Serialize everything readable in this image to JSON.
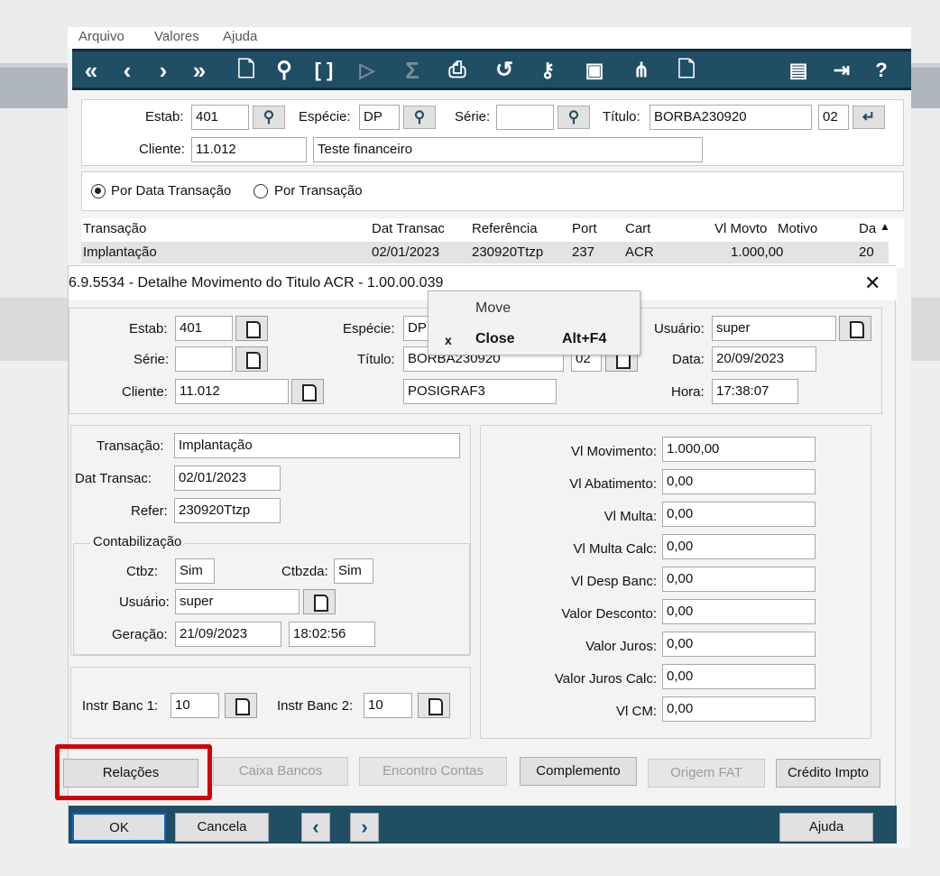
{
  "main": {
    "menu": [
      "Arquivo",
      "Valores",
      "Ajuda"
    ],
    "filter": {
      "estab_label": "Estab:",
      "estab": "401",
      "especie_label": "Espécie:",
      "especie": "DP",
      "serie_label": "Série:",
      "serie": "",
      "titulo_label": "Título:",
      "titulo": "BORBA230920",
      "parcela": "02",
      "cliente_label": "Cliente:",
      "cliente": "11.012",
      "cliente_nome": "Teste financeiro"
    },
    "radio": {
      "option1": "Por Data Transação",
      "option2": "Por Transação"
    },
    "grid": {
      "headers": [
        "Transação",
        "Dat Transac",
        "Referência",
        "Port",
        "Cart",
        "Vl Movto",
        "Motivo",
        "Da"
      ],
      "rows": [
        [
          "Implantação",
          "02/01/2023",
          "230920Ttzp",
          "237",
          "ACR",
          "1.000,00",
          "",
          "20"
        ]
      ]
    }
  },
  "dialog": {
    "title": "6.9.5534 - Detalhe Movimento do Titulo ACR - 1.00.00.039",
    "header": {
      "estab_label": "Estab:",
      "estab": "401",
      "serie_label": "Série:",
      "serie": "",
      "cliente_label": "Cliente:",
      "cliente": "11.012",
      "especie_label": "Espécie:",
      "especie": "DP",
      "titulo_label": "Título:",
      "titulo": "BORBA230920",
      "parcela": "02",
      "cliente_nome": "POSIGRAF3",
      "usuario_label": "Usuário:",
      "usuario": "super",
      "data_label": "Data:",
      "data": "20/09/2023",
      "hora_label": "Hora:",
      "hora": "17:38:07"
    },
    "left": {
      "transacao_label": "Transação:",
      "transacao": "Implantação",
      "dat_transac_label": "Dat Transac:",
      "dat_transac": "02/01/2023",
      "refer_label": "Refer:",
      "refer": "230920Ttzp",
      "contab_title": "Contabilização",
      "ctbz_label": "Ctbz:",
      "ctbz": "Sim",
      "ctbzda_label": "Ctbzda:",
      "ctbzda": "Sim",
      "usuario_label": "Usuário:",
      "usuario": "super",
      "geracao_label": "Geração:",
      "geracao_data": "21/09/2023",
      "geracao_hora": "18:02:56",
      "instr1_label": "Instr Banc 1:",
      "instr1": "10",
      "instr2_label": "Instr Banc 2:",
      "instr2": "10"
    },
    "values": [
      {
        "label": "Vl Movimento:",
        "value": "1.000,00"
      },
      {
        "label": "Vl Abatimento:",
        "value": "0,00"
      },
      {
        "label": "Vl Multa:",
        "value": "0,00"
      },
      {
        "label": "Vl Multa Calc:",
        "value": "0,00"
      },
      {
        "label": "Vl Desp Banc:",
        "value": "0,00"
      },
      {
        "label": "Valor Desconto:",
        "value": "0,00"
      },
      {
        "label": "Valor Juros:",
        "value": "0,00"
      },
      {
        "label": "Valor Juros Calc:",
        "value": "0,00"
      },
      {
        "label": "Vl CM:",
        "value": "0,00"
      }
    ],
    "buttons": {
      "relacoes": "Relações",
      "caixa_bancos": "Caixa Bancos",
      "encontro_contas": "Encontro Contas",
      "complemento": "Complemento",
      "origem_fat": "Origem FAT",
      "credito_impto": "Crédito Impto",
      "ok": "OK",
      "cancela": "Cancela",
      "ajuda": "Ajuda"
    }
  },
  "context_menu": {
    "move": "Move",
    "close": "Close",
    "close_shortcut": "Alt+F4",
    "close_icon": "x"
  },
  "colors": {
    "toolbar": "#1f4e65",
    "highlight": "#d40000"
  }
}
